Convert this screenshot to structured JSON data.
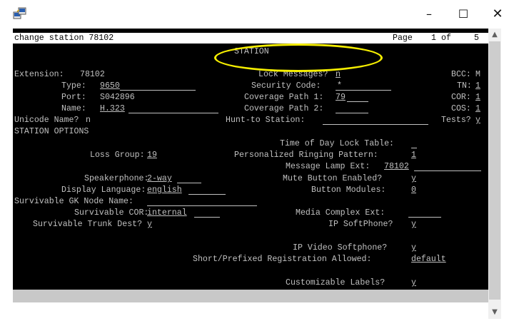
{
  "window": {
    "minimize_label": "–",
    "maximize_label": "☐",
    "close_label": "✕",
    "icon": "terminal-app-icon"
  },
  "header": {
    "command": "change station 78102",
    "page_label": "Page",
    "page_current": "1",
    "page_of": "of",
    "page_total": "5"
  },
  "form": {
    "title": "STATION",
    "extension_label": "Extension:",
    "extension_value": "78102",
    "type_label": "Type:",
    "type_value": "9650",
    "port_label": "Port:",
    "port_value": "S042896",
    "name_label": "Name:",
    "name_value": "H.323",
    "unicode_label": "Unicode Name?",
    "unicode_value": "n",
    "lock_messages_label": "Lock Messages?",
    "lock_messages_value": "n",
    "security_code_label": "Security Code:",
    "security_code_value": "*",
    "coverage_path_1_label": "Coverage Path 1:",
    "coverage_path_1_value": "79",
    "coverage_path_2_label": "Coverage Path 2:",
    "hunt_to_label": "Hunt-to Station:",
    "bcc_label": "BCC:",
    "bcc_value": "M",
    "tn_label": "TN:",
    "tn_value": "1",
    "cor_label": "COR:",
    "cor_value": "1",
    "cos_label": "COS:",
    "cos_value": "1",
    "tests_label": "Tests?",
    "tests_value": "y"
  },
  "options": {
    "section_title": "STATION OPTIONS",
    "time_of_day_label": "Time of Day Lock Table:",
    "loss_group_label": "Loss Group:",
    "loss_group_value": "19",
    "ringing_pattern_label": "Personalized Ringing Pattern:",
    "ringing_pattern_value": "1",
    "lamp_ext_label": "Message Lamp Ext:",
    "lamp_ext_value": "78102",
    "speakerphone_label": "Speakerphone:",
    "speakerphone_value": "2-way",
    "mute_label": "Mute Button Enabled?",
    "mute_value": "y",
    "display_lang_label": "Display Language:",
    "display_lang_value": "english",
    "button_modules_label": "Button Modules:",
    "button_modules_value": "0",
    "gk_node_label": "Survivable GK Node Name:",
    "surv_cor_label": "Survivable COR:",
    "surv_cor_value": "internal",
    "media_complex_label": "Media Complex Ext:",
    "surv_trunk_label": "Survivable Trunk Dest?",
    "surv_trunk_value": "y",
    "ip_softphone_label": "IP SoftPhone?",
    "ip_softphone_value": "y",
    "ip_video_label": "IP Video Softphone?",
    "ip_video_value": "y",
    "short_reg_label": "Short/Prefixed Registration Allowed:",
    "short_reg_value": "default",
    "custom_labels_label": "Customizable Labels?",
    "custom_labels_value": "y"
  },
  "scrollbar": {
    "up_arrow": "▲",
    "down_arrow": "▼"
  },
  "colors": {
    "terminal_bg": "#000000",
    "terminal_fg": "#c0c0c0",
    "highlight": "#f5ee00"
  }
}
